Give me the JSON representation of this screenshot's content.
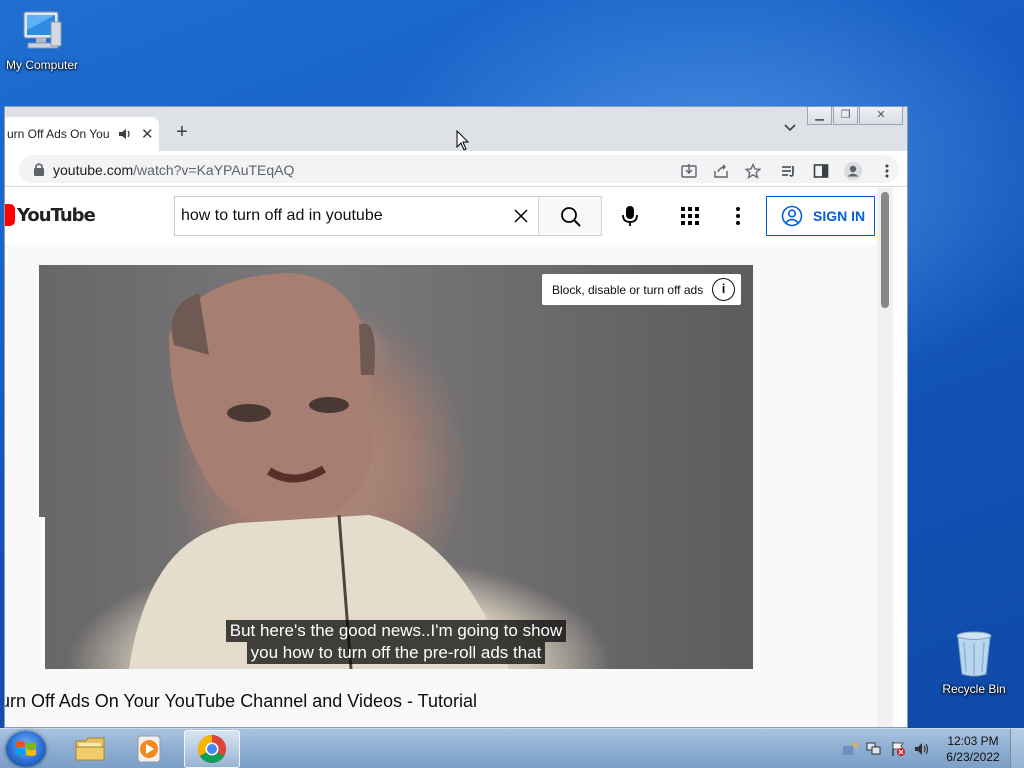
{
  "desktop": {
    "icons": [
      {
        "label": "My Computer"
      },
      {
        "label": "Recycle Bin"
      }
    ]
  },
  "browser": {
    "tab": {
      "title": "Turn Off Ads On Your YouTube Channel and Videos - Tutorial",
      "visible_title": "urn Off Ads On You"
    },
    "new_tab_label": "+",
    "address": {
      "host": "youtube.com",
      "path": "/watch?v=KaYPAuTEqAQ"
    }
  },
  "youtube": {
    "logo_text": "YouTube",
    "search_query": "how to turn off ad in youtube",
    "signin_label": "SIGN IN",
    "info_chip": "Block, disable or turn off ads",
    "info_icon_glyph": "i",
    "caption_line1": "But here's the good news..I'm going to show",
    "caption_line2": "you how to turn off the pre-roll ads that",
    "video_title": "urn Off Ads On Your YouTube Channel and Videos - Tutorial"
  },
  "taskbar": {
    "time": "12:03 PM",
    "date": "6/23/2022"
  },
  "colors": {
    "youtube_red": "#ff0000",
    "signin_blue": "#065fd4",
    "chrome_frame": "#dee1e6"
  }
}
